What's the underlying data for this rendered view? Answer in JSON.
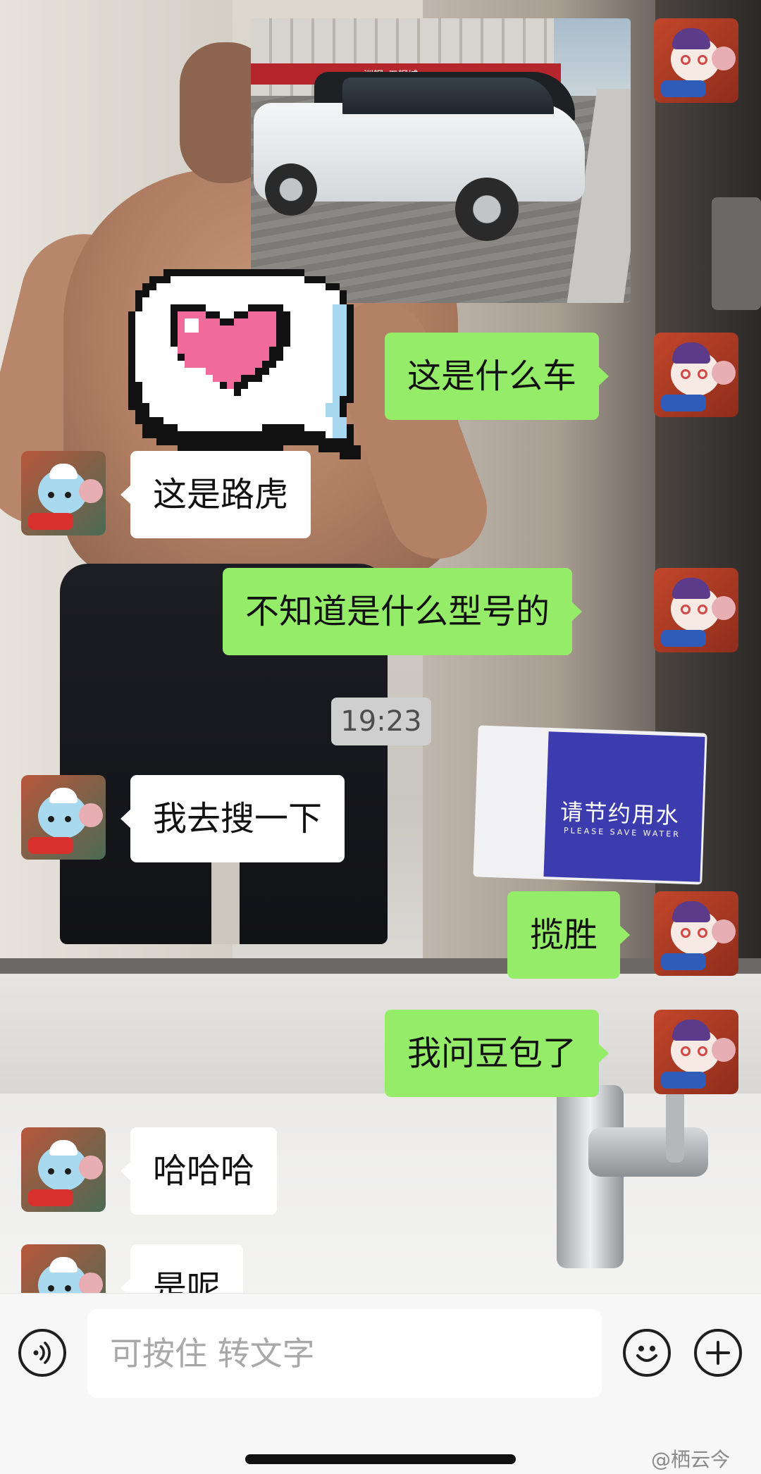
{
  "chat": {
    "messages": [
      {
        "side": "right",
        "type": "image"
      },
      {
        "side": "right",
        "text": "这是什么车"
      },
      {
        "side": "left",
        "text": "这是路虎"
      },
      {
        "side": "right",
        "text": "不知道是什么型号的"
      },
      {
        "side": "left",
        "text": "我去搜一下"
      },
      {
        "side": "right",
        "text": "揽胜"
      },
      {
        "side": "right",
        "text": "我问豆包了"
      },
      {
        "side": "left",
        "text": "哈哈哈"
      },
      {
        "side": "left",
        "text": "是呢"
      }
    ],
    "timestamp": "19:23",
    "background_sign": {
      "title": "请节约用水",
      "subtitle": "PLEASE SAVE WATER"
    },
    "photo_shop_sign": "洲钢_五钢城"
  },
  "input_bar": {
    "placeholder": "可按住 转文字",
    "voice_icon": "voice-icon",
    "emoji_icon": "emoji-icon",
    "plus_icon": "plus-icon"
  },
  "watermark": "@栖云今",
  "colors": {
    "self_bubble": "#95ec69",
    "other_bubble": "#ffffff",
    "input_bar_bg": "#f7f7f7",
    "timestamp_bg": "#cfcfcf"
  }
}
